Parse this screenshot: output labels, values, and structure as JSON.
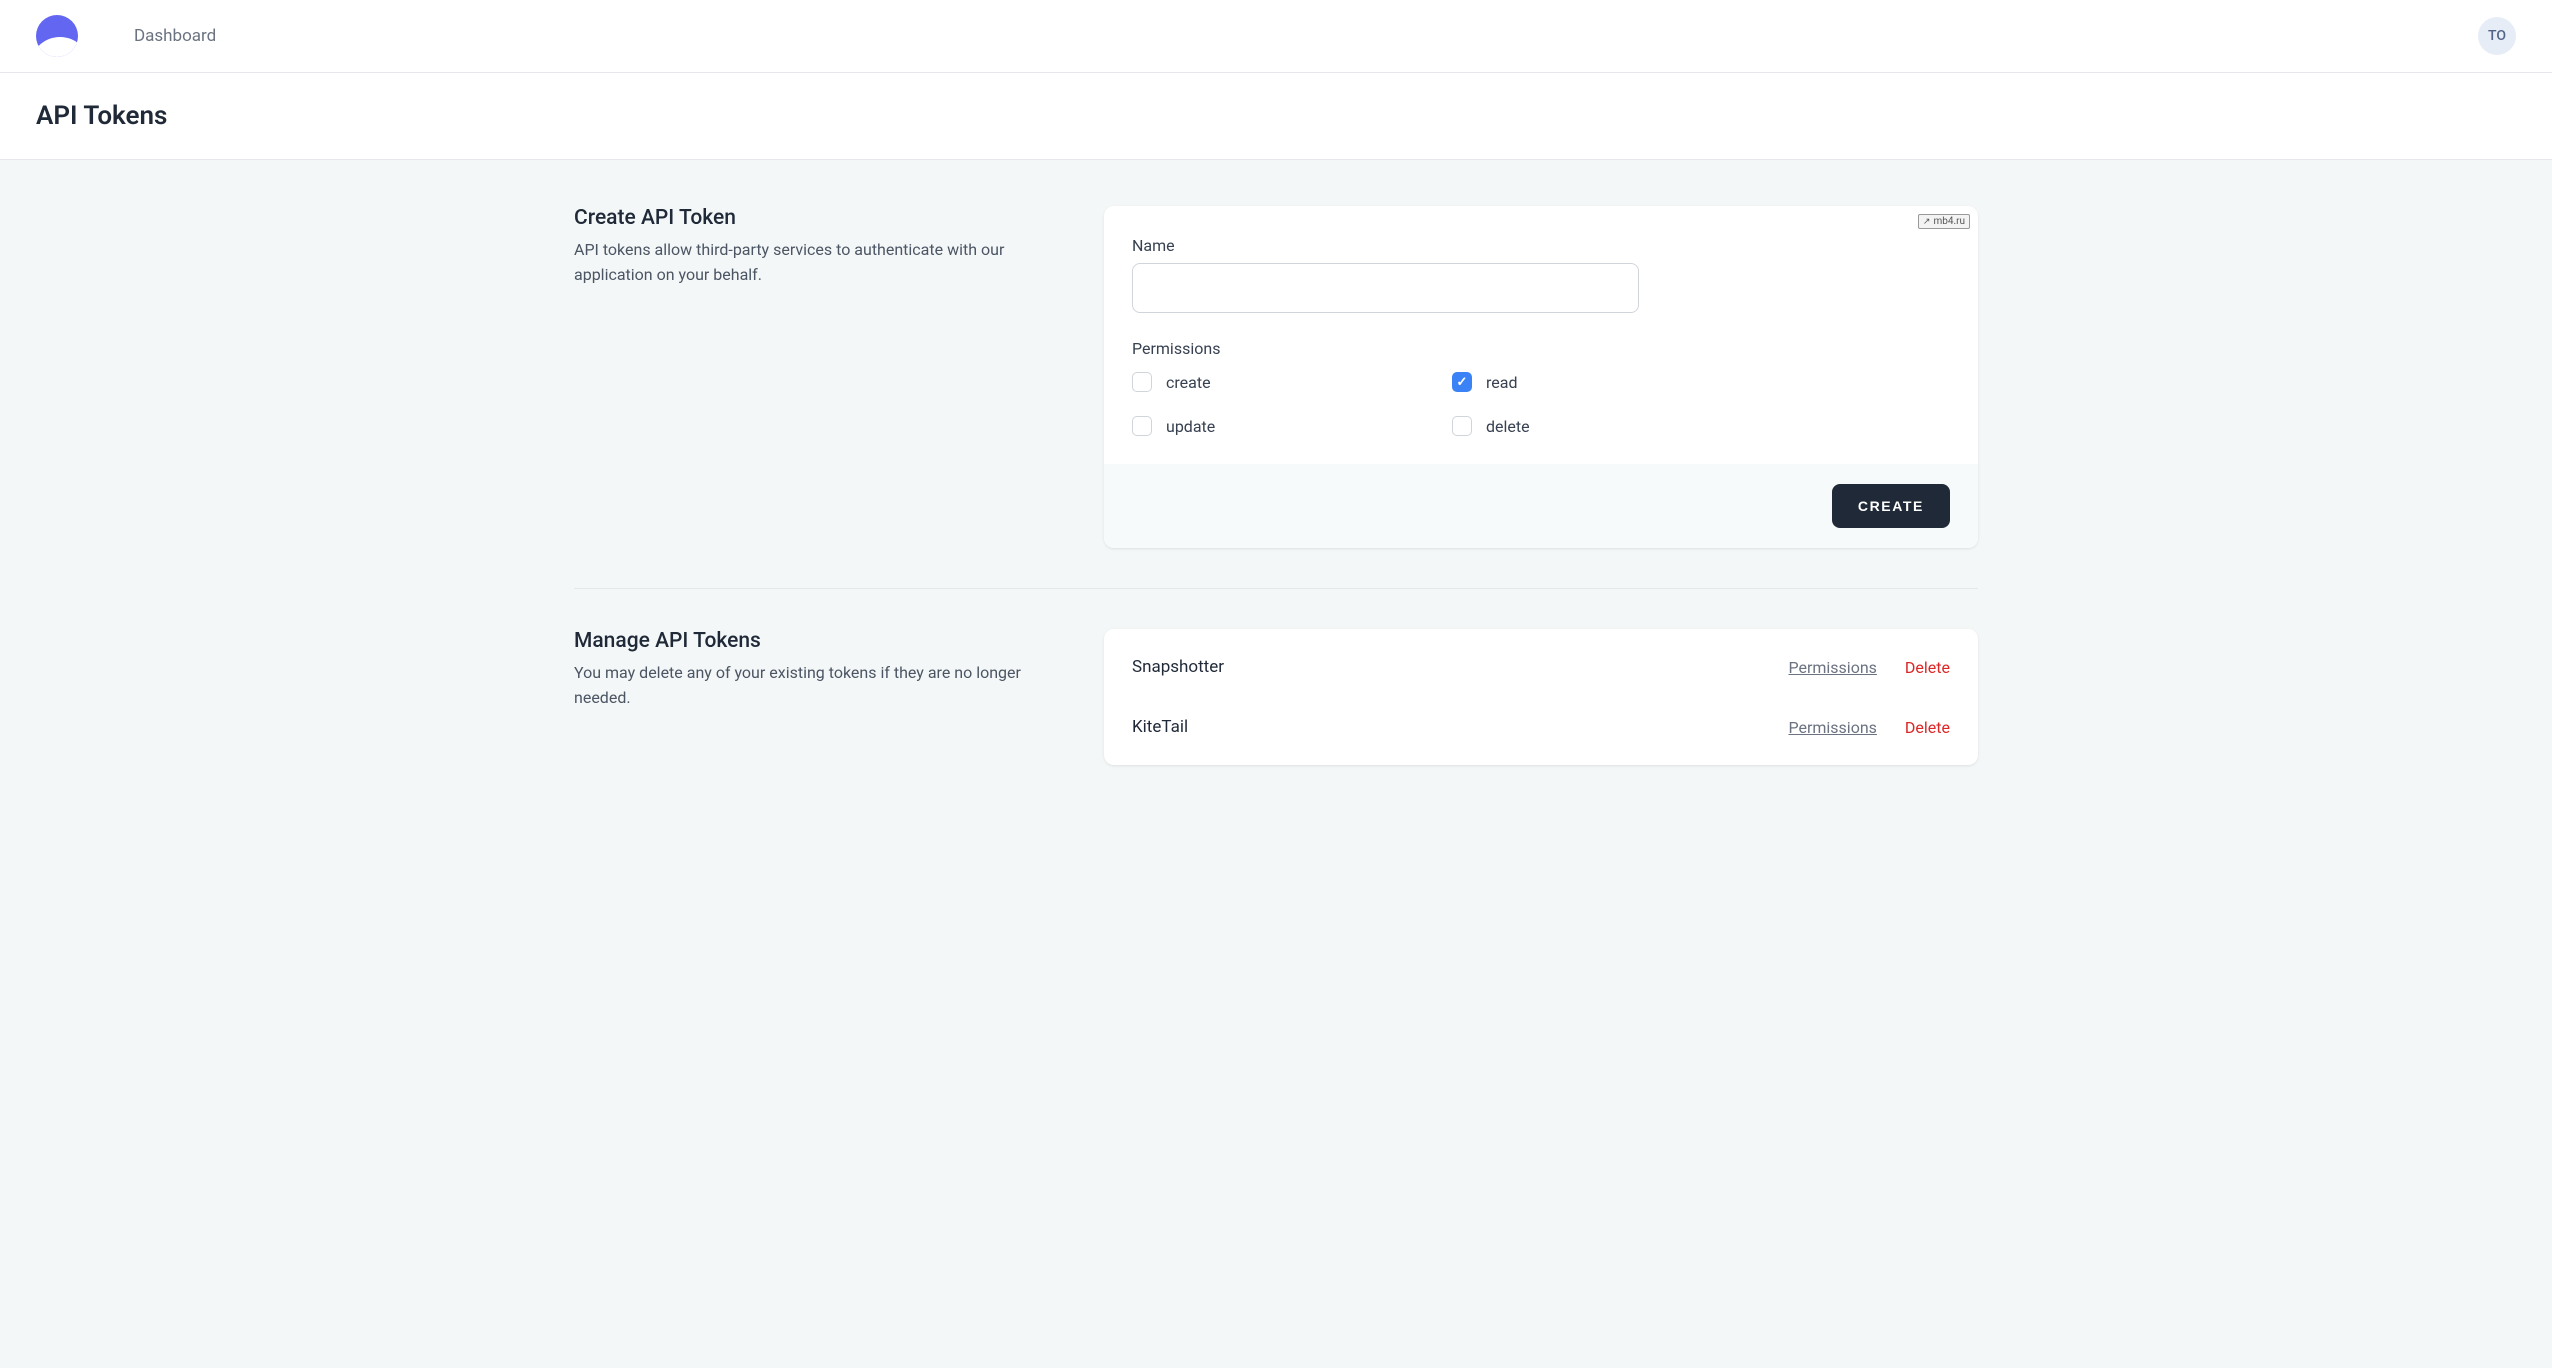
{
  "topbar": {
    "nav_link": "Dashboard",
    "avatar_initials": "TO"
  },
  "page_title": "API Tokens",
  "create_section": {
    "heading": "Create API Token",
    "description": "API tokens allow third-party services to authenticate with our application on your behalf.",
    "name_label": "Name",
    "name_value": "",
    "permissions_label": "Permissions",
    "permissions": [
      {
        "key": "create",
        "label": "create",
        "checked": false
      },
      {
        "key": "read",
        "label": "read",
        "checked": true
      },
      {
        "key": "update",
        "label": "update",
        "checked": false
      },
      {
        "key": "delete",
        "label": "delete",
        "checked": false
      }
    ],
    "submit_label": "CREATE",
    "watermark": "mb4.ru"
  },
  "manage_section": {
    "heading": "Manage API Tokens",
    "description": "You may delete any of your existing tokens if they are no longer needed.",
    "tokens": [
      {
        "name": "Snapshotter"
      },
      {
        "name": "KiteTail"
      }
    ],
    "permissions_link_label": "Permissions",
    "delete_link_label": "Delete"
  }
}
